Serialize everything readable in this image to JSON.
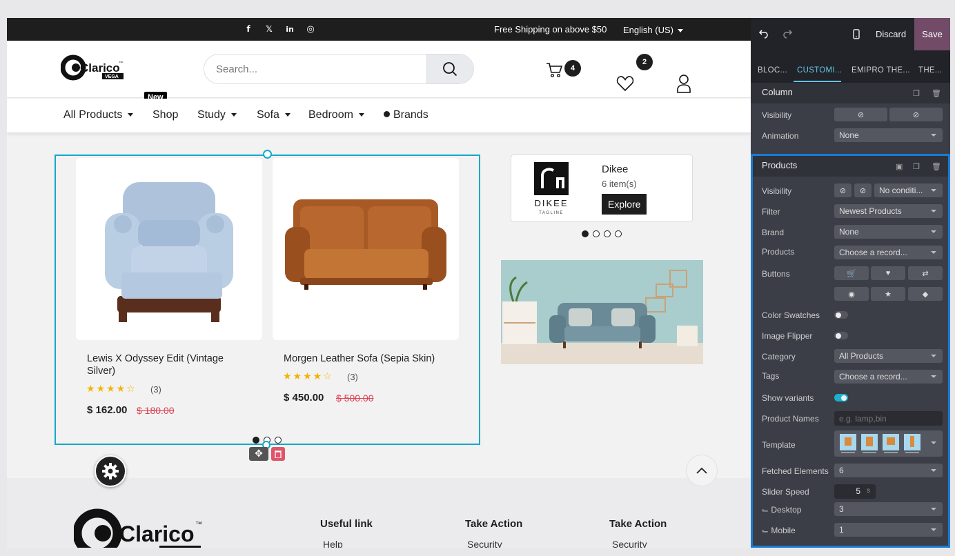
{
  "topbar": {
    "social": [
      "f",
      "𝕏",
      "in",
      "◎"
    ],
    "shipping": "Free Shipping on above $50",
    "language": "English (US)"
  },
  "header": {
    "search_placeholder": "Search...",
    "cart_count": "4",
    "wishlist_count": "2"
  },
  "nav": {
    "items": [
      "All Products",
      "Shop",
      "Study",
      "Sofa",
      "Bedroom",
      "Brands"
    ],
    "new_badge": "New"
  },
  "products": [
    {
      "name": "Lewis X Odyssey Edit (Vintage Silver)",
      "rating": 4,
      "reviews": "(3)",
      "price": "$ 162.00",
      "old_price": "$ 180.00"
    },
    {
      "name": "Morgen Leather Sofa (Sepia Skin)",
      "rating": 4,
      "reviews": "(3)",
      "price": "$ 450.00",
      "old_price": "$ 500.00"
    }
  ],
  "brand_card": {
    "name": "Dikee",
    "items": "6 item(s)",
    "button": "Explore",
    "logo_text": "DIKEE",
    "logo_sub": "TAGLINE"
  },
  "footer": {
    "headings": [
      "Useful link",
      "Take Action",
      "Take Action"
    ],
    "links": [
      "Help",
      "Security",
      "Security"
    ]
  },
  "editor": {
    "discard": "Discard",
    "save": "Save",
    "tabs": [
      "BLOC...",
      "CUSTOMI...",
      "EMIPRO THE...",
      "THE..."
    ],
    "column": {
      "title": "Column",
      "visibility_label": "Visibility",
      "animation_label": "Animation",
      "animation_value": "None"
    },
    "products": {
      "title": "Products",
      "visibility_label": "Visibility",
      "visibility_value": "No conditi...",
      "filter_label": "Filter",
      "filter_value": "Newest Products",
      "brand_label": "Brand",
      "brand_value": "None",
      "products_label": "Products",
      "products_value": "Choose a record...",
      "buttons_label": "Buttons",
      "color_swatches_label": "Color Swatches",
      "image_flipper_label": "Image Flipper",
      "category_label": "Category",
      "category_value": "All Products",
      "tags_label": "Tags",
      "tags_value": "Choose a record...",
      "show_variants_label": "Show variants",
      "product_names_label": "Product Names",
      "product_names_placeholder": "e.g. lamp,bin",
      "template_label": "Template",
      "fetched_label": "Fetched Elements",
      "fetched_value": "6",
      "slider_speed_label": "Slider Speed",
      "slider_speed_value": "5",
      "slider_speed_unit": "s",
      "desktop_label": "⌙ Desktop",
      "desktop_value": "3",
      "mobile_label": "⌙ Mobile",
      "mobile_value": "1"
    }
  },
  "colors": {
    "accent": "#13a9c9",
    "save": "#714b67",
    "selection": "#1a7bd4",
    "star": "#f5b301",
    "old_price": "#e04050"
  }
}
